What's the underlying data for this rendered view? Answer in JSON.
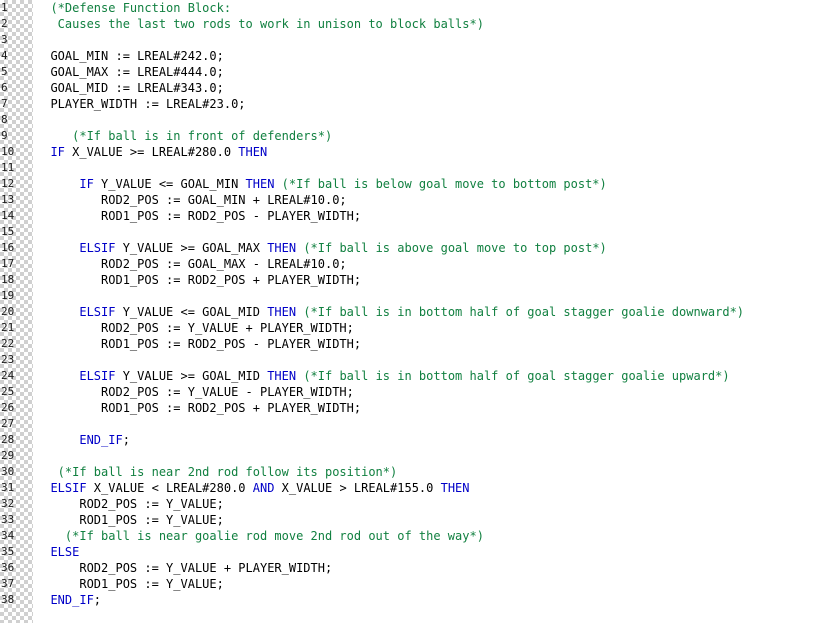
{
  "editor": {
    "language": "Structured Text",
    "total_lines": 38,
    "colors": {
      "keyword": "#0000c8",
      "comment": "#118040",
      "plain": "#000000",
      "line_number": "#1a1a1a",
      "background": "#ffffff"
    }
  },
  "line_numbers": [
    "1",
    "2",
    "3",
    "4",
    "5",
    "6",
    "7",
    "8",
    "9",
    "10",
    "11",
    "12",
    "13",
    "14",
    "15",
    "16",
    "17",
    "18",
    "19",
    "20",
    "21",
    "22",
    "23",
    "24",
    "25",
    "26",
    "27",
    "28",
    "29",
    "30",
    "31",
    "32",
    "33",
    "34",
    "35",
    "36",
    "37",
    "38"
  ],
  "lines": [
    {
      "n": "1",
      "tokens": [
        {
          "t": "comment",
          "s": "  (*Defense Function Block:"
        }
      ]
    },
    {
      "n": "2",
      "tokens": [
        {
          "t": "comment",
          "s": "   Causes the last two rods to work in unison to block balls*)"
        }
      ]
    },
    {
      "n": "3",
      "tokens": []
    },
    {
      "n": "4",
      "tokens": [
        {
          "t": "plain",
          "s": "  GOAL_MIN := LREAL#242.0;"
        }
      ]
    },
    {
      "n": "5",
      "tokens": [
        {
          "t": "plain",
          "s": "  GOAL_MAX := LREAL#444.0;"
        }
      ]
    },
    {
      "n": "6",
      "tokens": [
        {
          "t": "plain",
          "s": "  GOAL_MID := LREAL#343.0;"
        }
      ]
    },
    {
      "n": "7",
      "tokens": [
        {
          "t": "plain",
          "s": "  PLAYER_WIDTH := LREAL#23.0;"
        }
      ]
    },
    {
      "n": "8",
      "tokens": []
    },
    {
      "n": "9",
      "tokens": [
        {
          "t": "comment",
          "s": "     (*If ball is in front of defenders*)"
        }
      ]
    },
    {
      "n": "10",
      "tokens": [
        {
          "t": "kw",
          "s": "  IF"
        },
        {
          "t": "plain",
          "s": " X_VALUE >= LREAL#280.0 "
        },
        {
          "t": "kw",
          "s": "THEN"
        }
      ]
    },
    {
      "n": "11",
      "tokens": []
    },
    {
      "n": "12",
      "tokens": [
        {
          "t": "kw",
          "s": "      IF"
        },
        {
          "t": "plain",
          "s": " Y_VALUE <= GOAL_MIN "
        },
        {
          "t": "kw",
          "s": "THEN"
        },
        {
          "t": "comment",
          "s": " (*If ball is below goal move to bottom post*)"
        }
      ]
    },
    {
      "n": "13",
      "tokens": [
        {
          "t": "plain",
          "s": "         ROD2_POS := GOAL_MIN + LREAL#10.0;"
        }
      ]
    },
    {
      "n": "14",
      "tokens": [
        {
          "t": "plain",
          "s": "         ROD1_POS := ROD2_POS - PLAYER_WIDTH;"
        }
      ]
    },
    {
      "n": "15",
      "tokens": []
    },
    {
      "n": "16",
      "tokens": [
        {
          "t": "kw",
          "s": "      ELSIF"
        },
        {
          "t": "plain",
          "s": " Y_VALUE >= GOAL_MAX "
        },
        {
          "t": "kw",
          "s": "THEN"
        },
        {
          "t": "comment",
          "s": " (*If ball is above goal move to top post*)"
        }
      ]
    },
    {
      "n": "17",
      "tokens": [
        {
          "t": "plain",
          "s": "         ROD2_POS := GOAL_MAX - LREAL#10.0;"
        }
      ]
    },
    {
      "n": "18",
      "tokens": [
        {
          "t": "plain",
          "s": "         ROD1_POS := ROD2_POS + PLAYER_WIDTH;"
        }
      ]
    },
    {
      "n": "19",
      "tokens": []
    },
    {
      "n": "20",
      "tokens": [
        {
          "t": "kw",
          "s": "      ELSIF"
        },
        {
          "t": "plain",
          "s": " Y_VALUE <= GOAL_MID "
        },
        {
          "t": "kw",
          "s": "THEN"
        },
        {
          "t": "comment",
          "s": " (*If ball is in bottom half of goal stagger goalie downward*)"
        }
      ]
    },
    {
      "n": "21",
      "tokens": [
        {
          "t": "plain",
          "s": "         ROD2_POS := Y_VALUE + PLAYER_WIDTH;"
        }
      ]
    },
    {
      "n": "22",
      "tokens": [
        {
          "t": "plain",
          "s": "         ROD1_POS := ROD2_POS - PLAYER_WIDTH;"
        }
      ]
    },
    {
      "n": "23",
      "tokens": []
    },
    {
      "n": "24",
      "tokens": [
        {
          "t": "kw",
          "s": "      ELSIF"
        },
        {
          "t": "plain",
          "s": " Y_VALUE >= GOAL_MID "
        },
        {
          "t": "kw",
          "s": "THEN"
        },
        {
          "t": "comment",
          "s": " (*If ball is in bottom half of goal stagger goalie upward*)"
        }
      ]
    },
    {
      "n": "25",
      "tokens": [
        {
          "t": "plain",
          "s": "         ROD2_POS := Y_VALUE - PLAYER_WIDTH;"
        }
      ]
    },
    {
      "n": "26",
      "tokens": [
        {
          "t": "plain",
          "s": "         ROD1_POS := ROD2_POS + PLAYER_WIDTH;"
        }
      ]
    },
    {
      "n": "27",
      "tokens": []
    },
    {
      "n": "28",
      "tokens": [
        {
          "t": "kw",
          "s": "      END_IF"
        },
        {
          "t": "plain",
          "s": ";"
        }
      ]
    },
    {
      "n": "29",
      "tokens": []
    },
    {
      "n": "30",
      "tokens": [
        {
          "t": "comment",
          "s": "   (*If ball is near 2nd rod follow its position*)"
        }
      ]
    },
    {
      "n": "31",
      "tokens": [
        {
          "t": "kw",
          "s": "  ELSIF"
        },
        {
          "t": "plain",
          "s": " X_VALUE < LREAL#280.0 "
        },
        {
          "t": "kw",
          "s": "AND"
        },
        {
          "t": "plain",
          "s": " X_VALUE > LREAL#155.0 "
        },
        {
          "t": "kw",
          "s": "THEN"
        }
      ]
    },
    {
      "n": "32",
      "tokens": [
        {
          "t": "plain",
          "s": "      ROD2_POS := Y_VALUE;"
        }
      ]
    },
    {
      "n": "33",
      "tokens": [
        {
          "t": "plain",
          "s": "      ROD1_POS := Y_VALUE;"
        }
      ]
    },
    {
      "n": "34",
      "tokens": [
        {
          "t": "comment",
          "s": "    (*If ball is near goalie rod move 2nd rod out of the way*)"
        }
      ]
    },
    {
      "n": "35",
      "tokens": [
        {
          "t": "kw",
          "s": "  ELSE"
        }
      ]
    },
    {
      "n": "36",
      "tokens": [
        {
          "t": "plain",
          "s": "      ROD2_POS := Y_VALUE + PLAYER_WIDTH;"
        }
      ]
    },
    {
      "n": "37",
      "tokens": [
        {
          "t": "plain",
          "s": "      ROD1_POS := Y_VALUE;"
        }
      ]
    },
    {
      "n": "38",
      "tokens": [
        {
          "t": "kw",
          "s": "  END_IF"
        },
        {
          "t": "plain",
          "s": ";"
        }
      ]
    }
  ]
}
